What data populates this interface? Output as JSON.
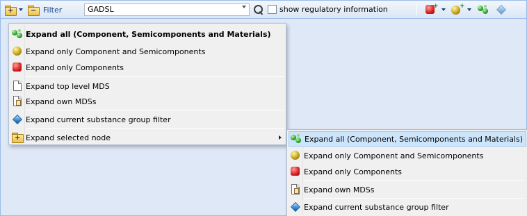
{
  "toolbar": {
    "filter_label": "Filter",
    "filter_value": "GADSL",
    "checkbox_label": "show regulatory information",
    "icons": [
      "expand-folder-icon",
      "collapse-folder-icon",
      "search-icon",
      "component-icon",
      "semicomponent-icon",
      "material-icon",
      "substance-group-icon"
    ]
  },
  "menu": {
    "items": [
      {
        "label": "Expand all (Component, Semicomponents and Materials)",
        "icon": "molecule-icon",
        "bold": true
      },
      {
        "label": "Expand only Component and Semicomponents",
        "icon": "semicomponent-icon"
      },
      {
        "label": "Expand only Components",
        "icon": "component-icon"
      },
      {
        "label": "Expand top level MDS",
        "icon": "document-icon"
      },
      {
        "label": "Expand own MDSs",
        "icon": "own-document-icon"
      },
      {
        "label": "Expand current substance group filter",
        "icon": "diamond-icon"
      },
      {
        "label": "Expand selected node",
        "icon": "expand-folder-icon",
        "has_submenu": true
      }
    ]
  },
  "submenu": {
    "items": [
      {
        "label": "Expand all (Component, Semicomponents and Materials)",
        "icon": "molecule-icon",
        "highlighted": true
      },
      {
        "label": "Expand only Component and Semicomponents",
        "icon": "semicomponent-icon"
      },
      {
        "label": "Expand only Components",
        "icon": "component-icon"
      },
      {
        "label": "Expand own MDSs",
        "icon": "own-document-icon"
      },
      {
        "label": "Expand current substance group filter",
        "icon": "diamond-icon"
      }
    ]
  }
}
